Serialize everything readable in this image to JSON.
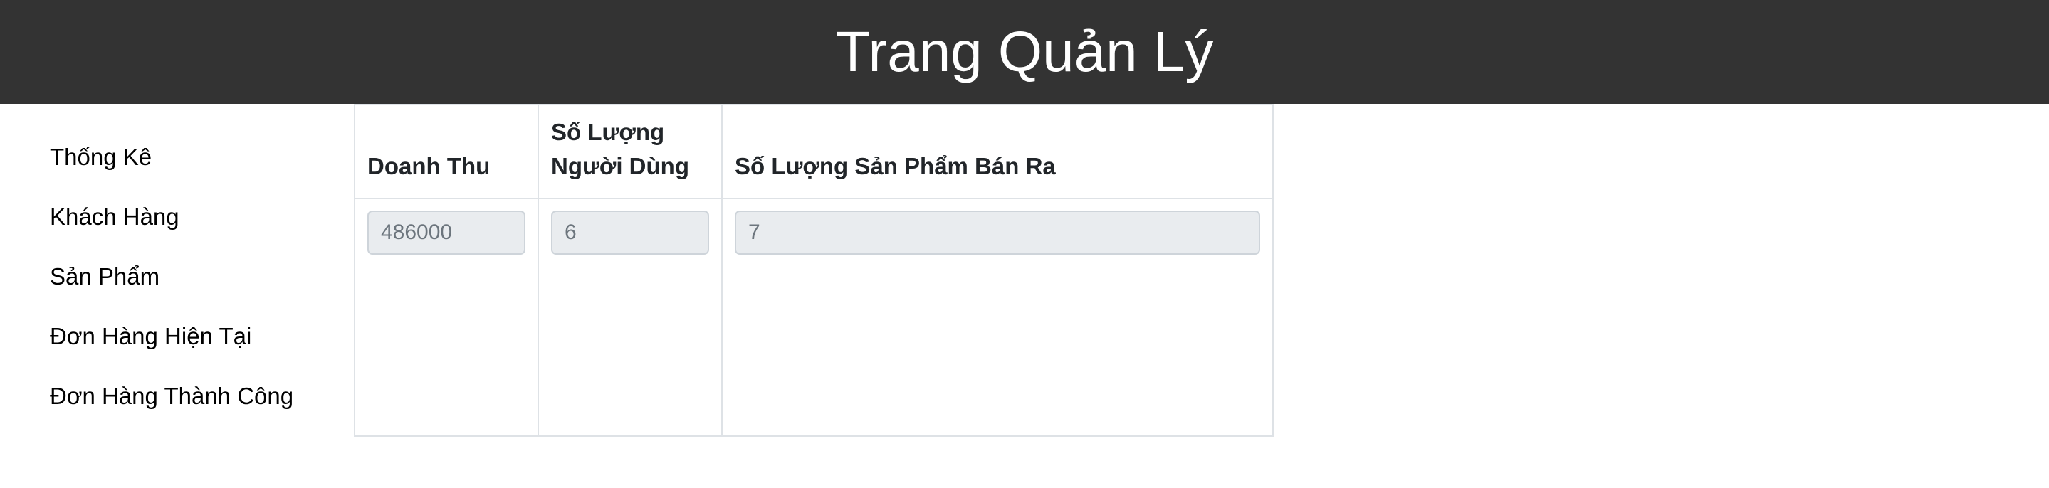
{
  "header": {
    "title": "Trang Quản Lý"
  },
  "sidebar": {
    "items": [
      {
        "label": "Thống Kê"
      },
      {
        "label": "Khách Hàng"
      },
      {
        "label": "Sản Phẩm"
      },
      {
        "label": "Đơn Hàng Hiện Tại"
      },
      {
        "label": "Đơn Hàng Thành Công"
      }
    ]
  },
  "stats": {
    "columns": [
      {
        "label": "Doanh Thu"
      },
      {
        "label": "Số Lượng Người Dùng"
      },
      {
        "label": "Số Lượng Sản Phẩm Bán Ra"
      }
    ],
    "values": [
      {
        "placeholder": "486000"
      },
      {
        "placeholder": "6"
      },
      {
        "placeholder": "7"
      }
    ]
  },
  "colors": {
    "header_bg": "#333333",
    "header_text": "#ffffff",
    "input_bg": "#e9ecef",
    "border": "#dee2e6"
  }
}
